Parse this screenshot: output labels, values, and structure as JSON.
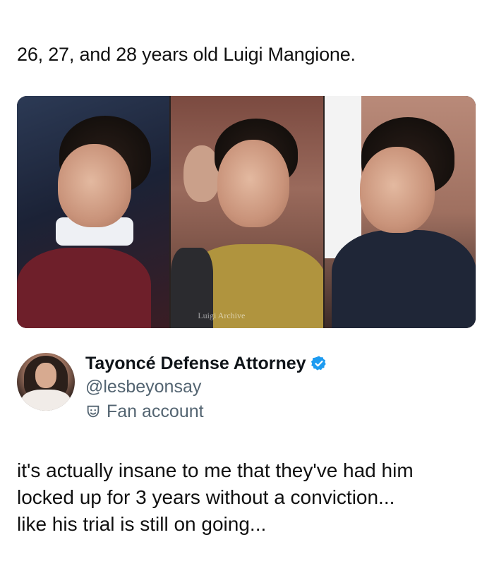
{
  "caption": "26, 27, and 28 years old Luigi Mangione.",
  "photos": {
    "watermark": "Luigi Archive"
  },
  "profile": {
    "display_name": "Tayoncé Defense Attorney",
    "handle": "@lesbeyonsay",
    "fan_label": "Fan account",
    "verified_color": "#1d9bf0"
  },
  "tweet": {
    "lines": [
      "it's actually insane to me that they've had him",
      "locked up for 3 years without a conviction...",
      "like his trial is still on going..."
    ]
  },
  "icons": {
    "verified": "verified-badge-icon",
    "fan": "theater-masks-icon"
  },
  "colors": {
    "text": "#0f1419",
    "muted": "#536471",
    "accent": "#1d9bf0"
  }
}
